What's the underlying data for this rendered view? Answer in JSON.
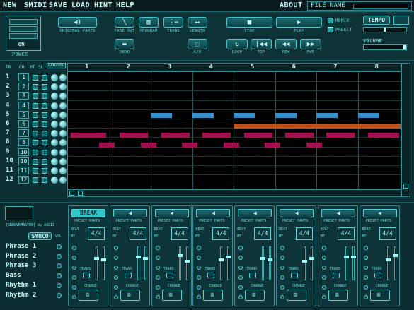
{
  "menu": {
    "items": [
      "NEW",
      "SMIDI",
      "SAVE",
      "LOAD",
      "HINT",
      "HELP"
    ],
    "about": "ABOUT",
    "file_name_label": "FILE NAME",
    "file_name_value": ""
  },
  "top": {
    "power_label": "POWER",
    "power_state": "ON",
    "original_parts": "ORIGINAL PARTS",
    "fade_out": "FADE OUT",
    "program": "PROGRAM",
    "trans": "TRANS",
    "length": "LENGTH",
    "stop": "STOP",
    "play": "PLAY",
    "remix": "REMIX",
    "preset": "PRESET",
    "tempo": "TEMPO",
    "volume": "VOLUME",
    "undo": "UNDO",
    "ab": "A/B",
    "loop": "LOOP",
    "top": "TOP",
    "rew": "REW",
    "ffwd": "FWD"
  },
  "sequencer": {
    "col_headers": [
      "TR",
      "CH",
      "MT",
      "SL",
      "PAN/VOL"
    ],
    "measures": [
      "1",
      "2",
      "3",
      "4",
      "5",
      "6",
      "7",
      "8"
    ],
    "tracks": [
      {
        "tr": "1",
        "ch": "1"
      },
      {
        "tr": "2",
        "ch": "2"
      },
      {
        "tr": "3",
        "ch": "3"
      },
      {
        "tr": "4",
        "ch": "4"
      },
      {
        "tr": "5",
        "ch": "5"
      },
      {
        "tr": "6",
        "ch": "6"
      },
      {
        "tr": "7",
        "ch": "7"
      },
      {
        "tr": "8",
        "ch": "8"
      },
      {
        "tr": "9",
        "ch": "10"
      },
      {
        "tr": "10",
        "ch": "10"
      },
      {
        "tr": "11",
        "ch": "11"
      },
      {
        "tr": "12",
        "ch": "12"
      }
    ],
    "colors": {
      "track5": "#3a8fc9",
      "track6": "#c2521a",
      "track78": "#a01050"
    }
  },
  "bottom": {
    "credit": "[GROOVEMASTER] by ASCII",
    "synco": "SYNCO",
    "vol": "VOL",
    "phrases": [
      "Phrase 1",
      "Phrase 2",
      "Phrase 3",
      "Bass",
      "Rhythm 1",
      "Rhythm 2"
    ],
    "part_first_label": "BREAK",
    "part_preset": "PRESET PARTS",
    "part_beat": "BEAT",
    "part_meter": "4/4",
    "part_mt": "MT",
    "part_trans": "TRANS",
    "part_change": "CHANGE"
  }
}
